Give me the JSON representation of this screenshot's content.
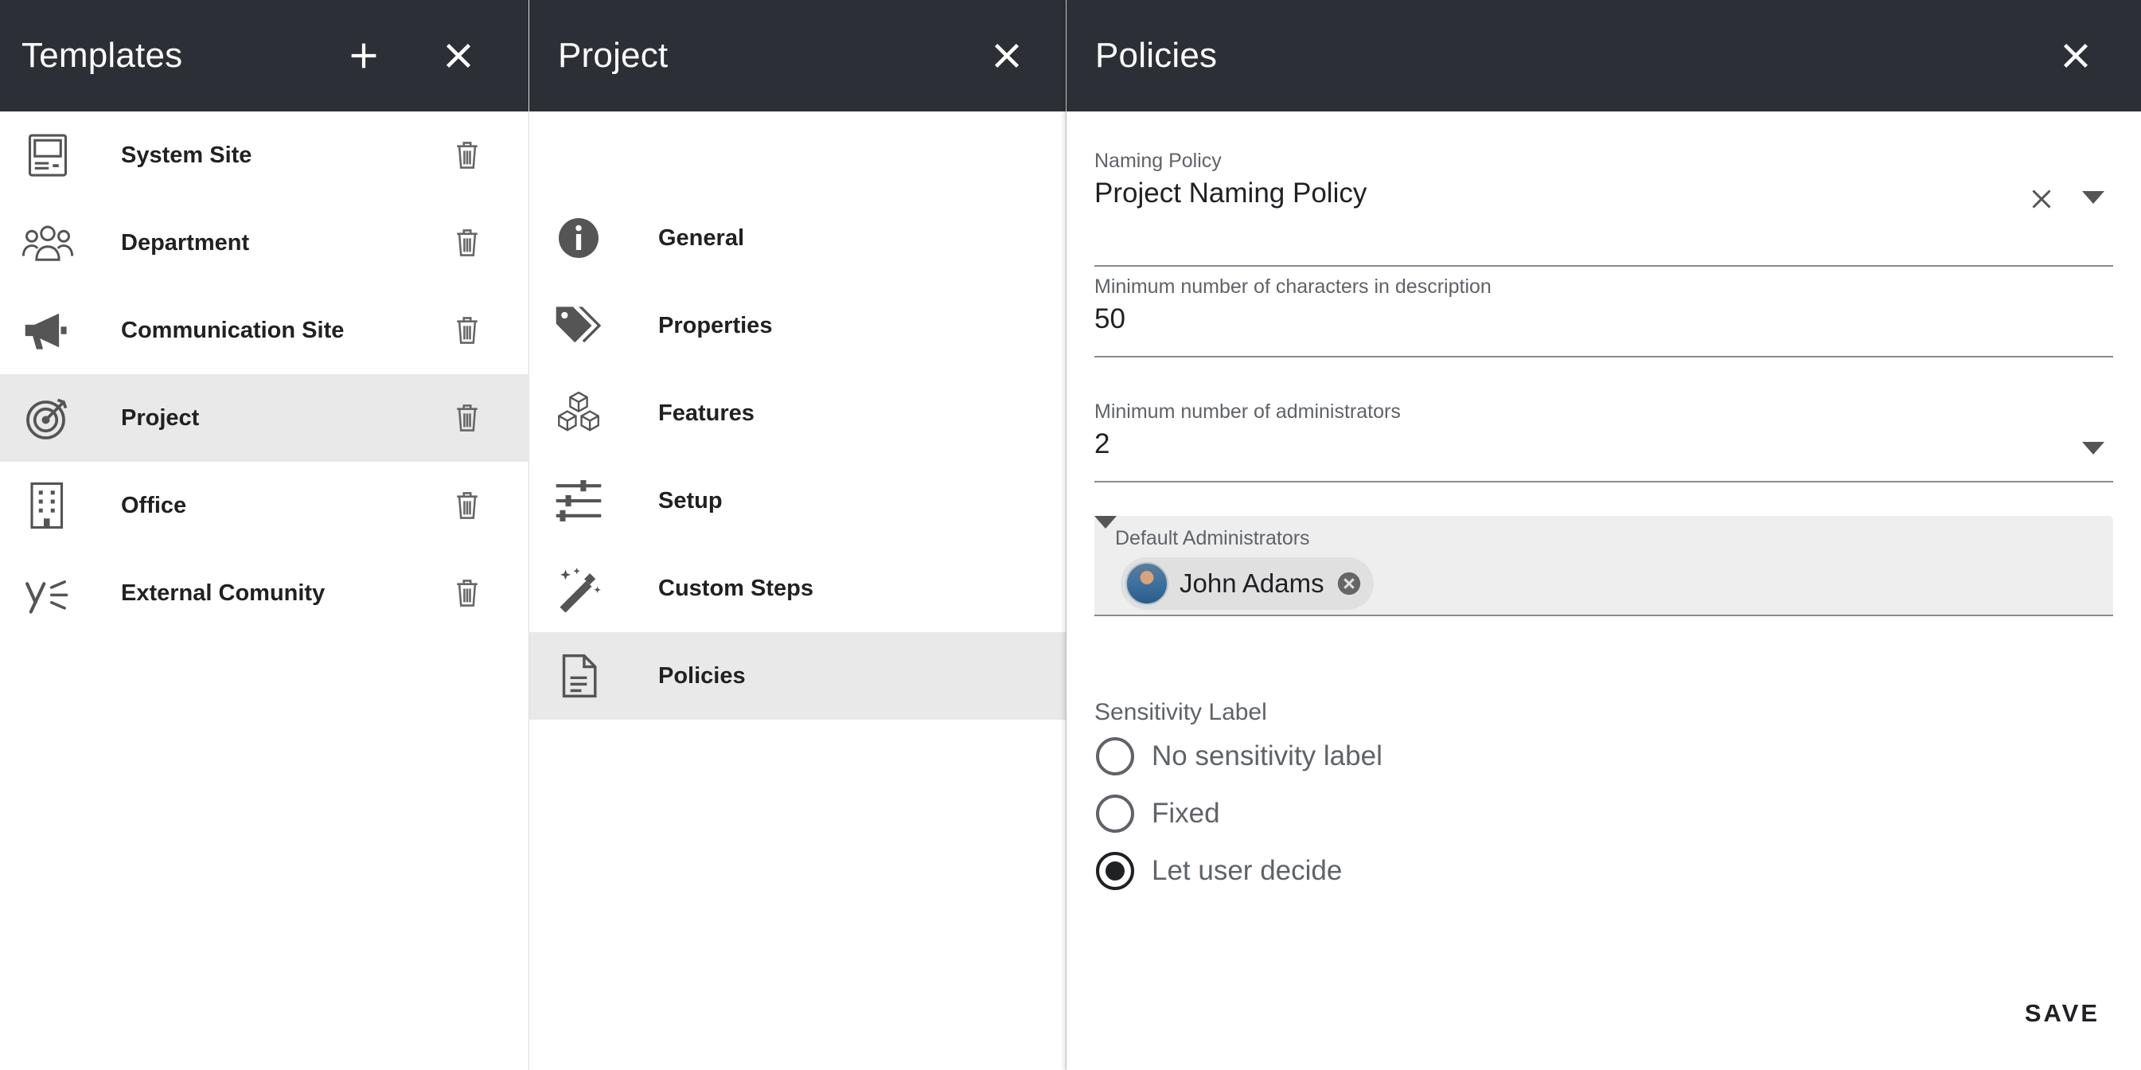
{
  "templates_panel": {
    "title": "Templates",
    "items": [
      {
        "label": "System Site",
        "icon": "system-site-icon"
      },
      {
        "label": "Department",
        "icon": "people-group-icon"
      },
      {
        "label": "Communication Site",
        "icon": "megaphone-icon"
      },
      {
        "label": "Project",
        "icon": "target-icon",
        "selected": true
      },
      {
        "label": "Office",
        "icon": "building-icon"
      },
      {
        "label": "External Comunity",
        "icon": "yammer-icon"
      }
    ]
  },
  "project_panel": {
    "title": "Project",
    "items": [
      {
        "label": "General",
        "icon": "info-icon"
      },
      {
        "label": "Properties",
        "icon": "tags-icon"
      },
      {
        "label": "Features",
        "icon": "cubes-icon"
      },
      {
        "label": "Setup",
        "icon": "sliders-icon"
      },
      {
        "label": "Custom Steps",
        "icon": "magic-wand-icon"
      },
      {
        "label": "Policies",
        "icon": "document-icon",
        "selected": true
      }
    ]
  },
  "policies_panel": {
    "title": "Policies",
    "naming_policy": {
      "label": "Naming Policy",
      "value": "Project Naming Policy"
    },
    "min_description_chars": {
      "label": "Minimum number of characters in description",
      "value": "50"
    },
    "min_admins": {
      "label": "Minimum number of administrators",
      "value": "2"
    },
    "default_admins": {
      "label": "Default Administrators",
      "chips": [
        "John Adams"
      ]
    },
    "sensitivity": {
      "label": "Sensitivity Label",
      "options": [
        {
          "label": "No sensitivity label",
          "checked": false
        },
        {
          "label": "Fixed",
          "checked": false
        },
        {
          "label": "Let user decide",
          "checked": true
        }
      ]
    },
    "save_label": "SAVE"
  },
  "colors": {
    "header_bg": "#2c3036",
    "selected_row": "#e8e9e8",
    "field_fill": "#eeeeee"
  }
}
